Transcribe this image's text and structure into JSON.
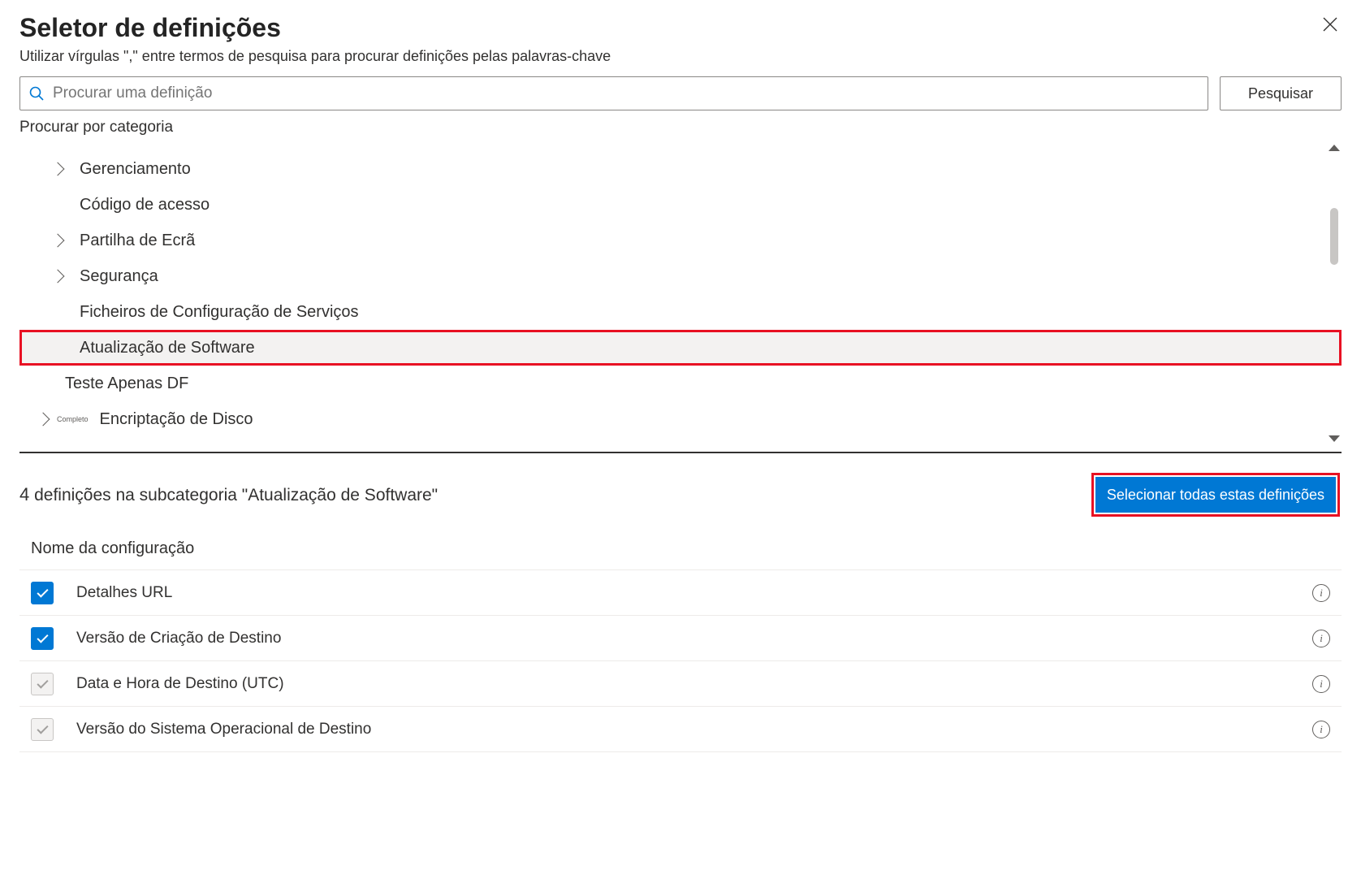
{
  "title": "Seletor de definições",
  "subtitle": "Utilizar vírgulas \",\" entre termos de pesquisa para procurar definições pelas palavras-chave",
  "search": {
    "placeholder": "Procurar uma definição",
    "button": "Pesquisar"
  },
  "browse_label": "Procurar por categoria",
  "tree": {
    "items": [
      {
        "label": "Gerenciamento",
        "expandable": true
      },
      {
        "label": "Código de acesso",
        "expandable": false
      },
      {
        "label": "Partilha de Ecrã",
        "expandable": true
      },
      {
        "label": "Segurança",
        "expandable": true
      },
      {
        "label": "Ficheiros de Configuração de Serviços",
        "expandable": false
      },
      {
        "label": "Atualização de Software",
        "expandable": false,
        "selected": true,
        "highlight": true
      },
      {
        "label": "Teste Apenas DF",
        "expandable": false,
        "outdent": true
      },
      {
        "label": "Encriptação de Disco",
        "expandable": true,
        "tag": "Completo",
        "outdent": true
      }
    ]
  },
  "results": {
    "count": "4",
    "text": " definições na subcategoria \"Atualização de Software\"",
    "select_all": "Selecionar todas estas definições"
  },
  "config_header": "Nome da configuração",
  "settings": [
    {
      "name": "Detalhes URL",
      "checked": true
    },
    {
      "name": "Versão de Criação de Destino",
      "checked": true
    },
    {
      "name": "Data e Hora de Destino (UTC)",
      "checked": false
    },
    {
      "name": "Versão do Sistema Operacional de Destino",
      "checked": false
    }
  ]
}
